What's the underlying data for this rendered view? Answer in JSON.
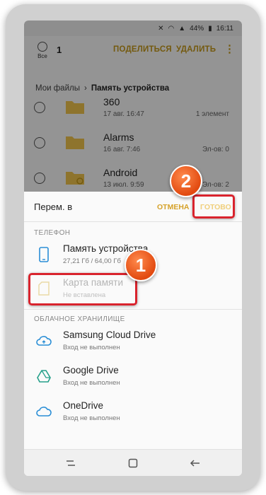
{
  "status_bar": {
    "battery": "44%",
    "time": "16:11"
  },
  "toolbar": {
    "select_all_label": "Все",
    "selected_count": "1",
    "share_label": "ПОДЕЛИТЬСЯ",
    "delete_label": "УДАЛИТЬ",
    "more_label": "⋮"
  },
  "breadcrumb": {
    "root": "Мои файлы",
    "separator": "›",
    "current": "Память устройства"
  },
  "files": [
    {
      "name": "360",
      "date": "17 авг. 16:47",
      "meta": "1 элемент"
    },
    {
      "name": "Alarms",
      "date": "16 авг. 7:46",
      "meta": "Эл-ов: 0"
    },
    {
      "name": "Android",
      "date": "13 июл. 9:59",
      "meta": "Эл-ов: 2"
    }
  ],
  "sheet": {
    "title": "Перем. в",
    "cancel_label": "ОТМЕНА",
    "done_label": "ГОТОВО",
    "phone_section": "ТЕЛЕФОН",
    "device_storage": {
      "name": "Память устройства",
      "detail": "27,21 Гб / 64,00 Гб"
    },
    "sd_card": {
      "name": "Карта памяти",
      "detail": "Не вставлена"
    },
    "cloud_section": "ОБЛАЧНОЕ ХРАНИЛИЩЕ",
    "clouds": [
      {
        "name": "Samsung Cloud Drive",
        "detail": "Вход не выполнен"
      },
      {
        "name": "Google Drive",
        "detail": "Вход не выполнен"
      },
      {
        "name": "OneDrive",
        "detail": "Вход не выполнен"
      }
    ]
  },
  "annotations": {
    "step1": "1",
    "step2": "2"
  },
  "colors": {
    "accent": "#c89b1a",
    "highlight": "#d9232d",
    "badge": "#e24a10"
  }
}
